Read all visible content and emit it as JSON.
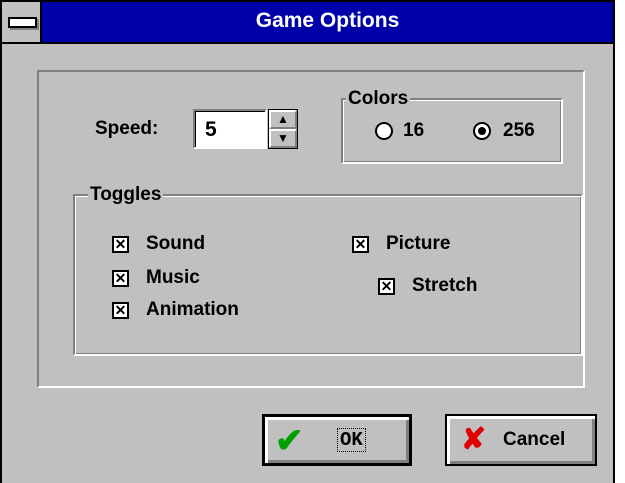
{
  "window": {
    "title": "Game Options",
    "system_menu_icon": "system-menu-icon"
  },
  "speed": {
    "label": "Speed:",
    "value": "5"
  },
  "colors": {
    "label": "Colors",
    "options": [
      {
        "label": "16",
        "selected": false
      },
      {
        "label": "256",
        "selected": true
      }
    ]
  },
  "toggles": {
    "label": "Toggles",
    "items": [
      {
        "label": "Sound",
        "checked": true
      },
      {
        "label": "Music",
        "checked": true
      },
      {
        "label": "Animation",
        "checked": true
      },
      {
        "label": "Picture",
        "checked": true
      },
      {
        "label": "Stretch",
        "checked": true
      }
    ]
  },
  "buttons": {
    "ok_label": "OK",
    "ok_icon": "checkmark-icon",
    "cancel_label": "Cancel",
    "cancel_icon": "x-icon"
  },
  "colors_palette": {
    "title_bar": "#0000a8",
    "face": "#c0c0c0",
    "ok_check": "#00a000",
    "cancel_x": "#e00000"
  }
}
